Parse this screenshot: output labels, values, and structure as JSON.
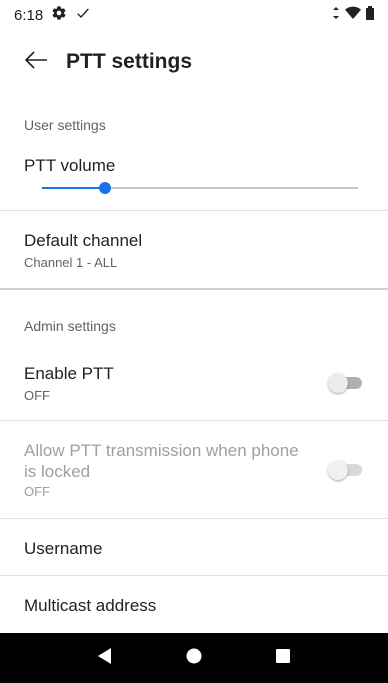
{
  "status_bar": {
    "time": "6:18",
    "icons": [
      "gear-icon",
      "check-icon",
      "vibrate-icon",
      "wifi-icon",
      "battery-icon"
    ]
  },
  "app_bar": {
    "title": "PTT settings",
    "back_icon": "back-arrow-icon"
  },
  "user_settings": {
    "header": "User settings",
    "volume": {
      "title": "PTT volume",
      "level": 0.2
    },
    "default_channel": {
      "title": "Default channel",
      "summary": "Channel 1 - ALL"
    }
  },
  "admin_settings": {
    "header": "Admin settings",
    "enable_ptt": {
      "title": "Enable PTT",
      "summary": "OFF",
      "checked": false
    },
    "allow_locked": {
      "title": "Allow PTT transmission when phone is locked",
      "summary": "OFF",
      "checked": false,
      "enabled": false
    },
    "username": {
      "title": "Username"
    },
    "multicast": {
      "title": "Multicast address"
    }
  },
  "colors": {
    "accent": "#1a73e8",
    "nav_bar": "#000000"
  }
}
